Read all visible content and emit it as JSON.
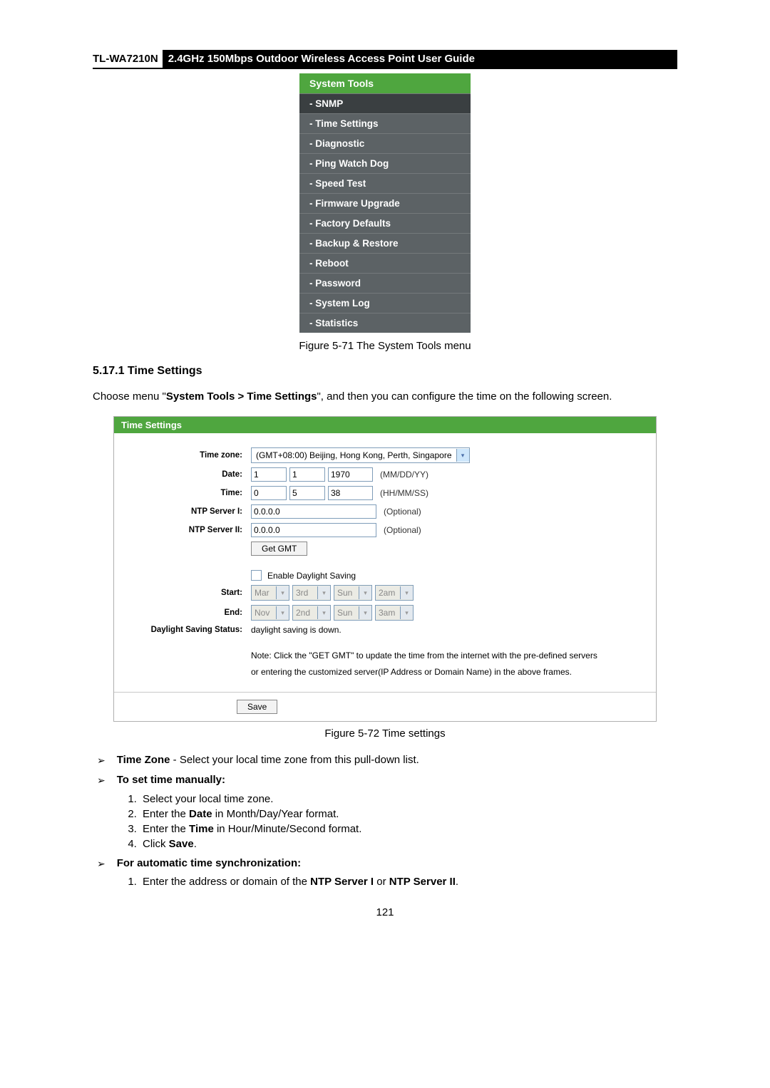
{
  "header": {
    "model": "TL-WA7210N",
    "title": "2.4GHz 150Mbps Outdoor Wireless Access Point User Guide"
  },
  "menu": {
    "header": "System Tools",
    "items": [
      "- SNMP",
      "- Time Settings",
      "- Diagnostic",
      "- Ping Watch Dog",
      "- Speed Test",
      "- Firmware Upgrade",
      "- Factory Defaults",
      "- Backup & Restore",
      "- Reboot",
      "- Password",
      "- System Log",
      "- Statistics"
    ]
  },
  "caption1": "Figure 5-71 The System Tools menu",
  "sectionHeading": "5.17.1 Time Settings",
  "para1_a": "Choose menu \"",
  "para1_b": "System Tools > Time Settings",
  "para1_c": "\", and then you can configure the time on the following screen.",
  "panel": {
    "title": "Time Settings",
    "labels": {
      "tz": "Time zone:",
      "date": "Date:",
      "time": "Time:",
      "ntp1": "NTP Server I:",
      "ntp2": "NTP Server II:",
      "start": "Start:",
      "end": "End:",
      "dss": "Daylight Saving Status:"
    },
    "tz_value": "(GMT+08:00) Beijing, Hong Kong, Perth, Singapore",
    "date": {
      "m": "1",
      "d": "1",
      "y": "1970",
      "hint": "(MM/DD/YY)"
    },
    "time": {
      "h": "0",
      "m": "5",
      "s": "38",
      "hint": "(HH/MM/SS)"
    },
    "ntp1": "0.0.0.0",
    "ntp2": "0.0.0.0",
    "optional": "(Optional)",
    "getgmt": "Get GMT",
    "enable_ds": "Enable Daylight Saving",
    "start_sel": [
      "Mar",
      "3rd",
      "Sun",
      "2am"
    ],
    "end_sel": [
      "Nov",
      "2nd",
      "Sun",
      "3am"
    ],
    "ds_status": "daylight saving is down.",
    "note1": "Note: Click the \"GET GMT\" to update the time from the internet with the pre-defined servers",
    "note2": "or entering the customized server(IP Address or Domain Name) in the above frames.",
    "save": "Save"
  },
  "caption2": "Figure 5-72 Time settings",
  "bullets": {
    "tz_a": "Time Zone",
    "tz_b": " - Select your local time zone from this pull-down list.",
    "manual": "To set time manually:",
    "auto": "For automatic time synchronization:"
  },
  "steps_manual": {
    "s1": "Select your local time zone.",
    "s2a": "Enter the ",
    "s2b": "Date",
    "s2c": " in Month/Day/Year format.",
    "s3a": "Enter the ",
    "s3b": "Time",
    "s3c": " in Hour/Minute/Second format.",
    "s4a": "Click ",
    "s4b": "Save",
    "s4c": "."
  },
  "steps_auto": {
    "s1a": "Enter the address or domain of the ",
    "s1b": "NTP Server I",
    "s1c": " or ",
    "s1d": "NTP Server II",
    "s1e": "."
  },
  "pageNum": "121",
  "glyphs": {
    "tri": "➢",
    "down": "▾"
  }
}
